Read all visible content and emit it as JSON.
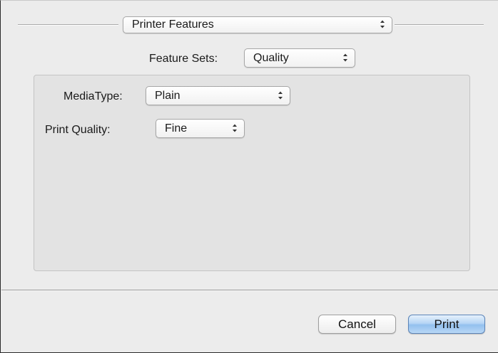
{
  "panel_selector": {
    "value": "Printer Features"
  },
  "feature_sets": {
    "label": "Feature Sets:",
    "value": "Quality"
  },
  "options": {
    "media_type": {
      "label": "MediaType:",
      "value": "Plain"
    },
    "print_quality": {
      "label": "Print Quality:",
      "value": "Fine"
    }
  },
  "buttons": {
    "cancel": "Cancel",
    "print": "Print"
  },
  "colors": {
    "dialog_bg": "#ececec",
    "group_box_bg": "#e3e3e3",
    "default_button_accent": "#93c0ee"
  },
  "icons": {
    "popup_indicator": "up-down-arrows-icon"
  }
}
